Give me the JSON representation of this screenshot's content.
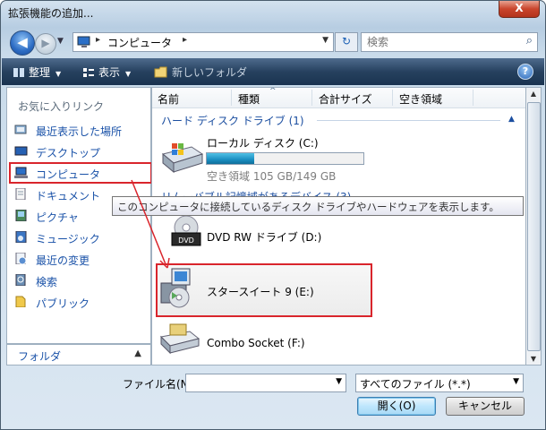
{
  "window": {
    "title": "拡張機能の追加...",
    "close_label": "X"
  },
  "address": {
    "location": "コンピュータ",
    "arrow": "▸"
  },
  "search": {
    "placeholder": "検索"
  },
  "toolbar": {
    "organize": "整理",
    "view": "表示",
    "new_folder": "新しいフォルダ",
    "help": "?"
  },
  "sidebar": {
    "favorites_header": "お気に入りリンク",
    "items": [
      {
        "label": "最近表示した場所",
        "icon": "recent-places-icon"
      },
      {
        "label": "デスクトップ",
        "icon": "desktop-icon"
      },
      {
        "label": "コンピュータ",
        "icon": "computer-icon",
        "selected": true
      },
      {
        "label": "ドキュメント",
        "icon": "documents-icon"
      },
      {
        "label": "ピクチャ",
        "icon": "pictures-icon"
      },
      {
        "label": "ミュージック",
        "icon": "music-icon"
      },
      {
        "label": "最近の変更",
        "icon": "recent-changes-icon"
      },
      {
        "label": "検索",
        "icon": "search-folder-icon"
      },
      {
        "label": "パブリック",
        "icon": "public-folder-icon"
      }
    ],
    "folders_label": "フォルダ"
  },
  "columns": [
    "名前",
    "種類",
    "合計サイズ",
    "空き領域"
  ],
  "groups": {
    "hdd": "ハード ディスク ドライブ (1)",
    "removable": "リムーバブル記憶域があるデバイス (3)"
  },
  "drives": {
    "local": {
      "name": "ローカル ディスク (C:)",
      "free_text": "空き領域 105 GB/149 GB",
      "used_fraction": 0.3
    },
    "dvd": {
      "name": "DVD RW ドライブ (D:)",
      "badge": "DVD"
    },
    "star": {
      "name": "スタースイート 9 (E:)"
    },
    "combo": {
      "name": "Combo Socket (F:)"
    }
  },
  "tooltip": "このコンピュータに接続しているディスク ドライブやハードウェアを表示します。",
  "footer": {
    "filename_label": "ファイル名(N):",
    "filename_value": "",
    "filetype": "すべてのファイル (*.*)",
    "open": "開く(O)",
    "cancel": "キャンセル"
  }
}
